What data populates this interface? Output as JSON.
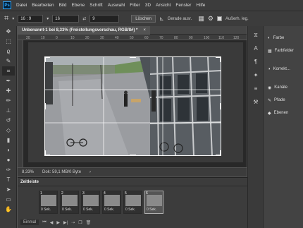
{
  "app": {
    "logo": "Ps"
  },
  "menu": [
    "Datei",
    "Bearbeiten",
    "Bild",
    "Ebene",
    "Schrift",
    "Auswahl",
    "Filter",
    "3D",
    "Ansicht",
    "Fenster",
    "Hilfe"
  ],
  "options": {
    "ratio": "16 : 9",
    "width": "16",
    "height": "9",
    "clear_label": "Löschen",
    "straighten_label": "Gerade ausr.",
    "outside_label": "Außerh. leg."
  },
  "document": {
    "tab_title": "Unbenannt-1 bei 8,33% (Freistellungsvorschau, RGB/8#) *",
    "close": "×",
    "ruler_marks": [
      "20",
      "10",
      "0",
      "10",
      "20",
      "30",
      "40",
      "50",
      "60",
      "70",
      "80",
      "90",
      "100",
      "110",
      "120"
    ]
  },
  "status": {
    "zoom": "8,33%",
    "doc": "Dok: 59,1 MB/0 Byte"
  },
  "panels": {
    "items": [
      {
        "label": "Farbe",
        "icon": "color-wheel-icon"
      },
      {
        "label": "Farbfelder",
        "icon": "swatches-icon"
      },
      {
        "label": "Korrekt...",
        "icon": "adjustments-icon"
      },
      {
        "label": "Kanäle",
        "icon": "channels-icon"
      },
      {
        "label": "Pfade",
        "icon": "paths-icon"
      },
      {
        "label": "Ebenen",
        "icon": "layers-icon"
      }
    ]
  },
  "timeline": {
    "title": "Zeitleiste",
    "frames": [
      {
        "num": "1",
        "delay": "0 Sek."
      },
      {
        "num": "2",
        "delay": "0 Sek."
      },
      {
        "num": "3",
        "delay": "0 Sek."
      },
      {
        "num": "4",
        "delay": "0 Sek."
      },
      {
        "num": "5",
        "delay": "0 Sek."
      },
      {
        "num": "6",
        "delay": "0 Sek."
      }
    ],
    "loop": "Einmal"
  }
}
